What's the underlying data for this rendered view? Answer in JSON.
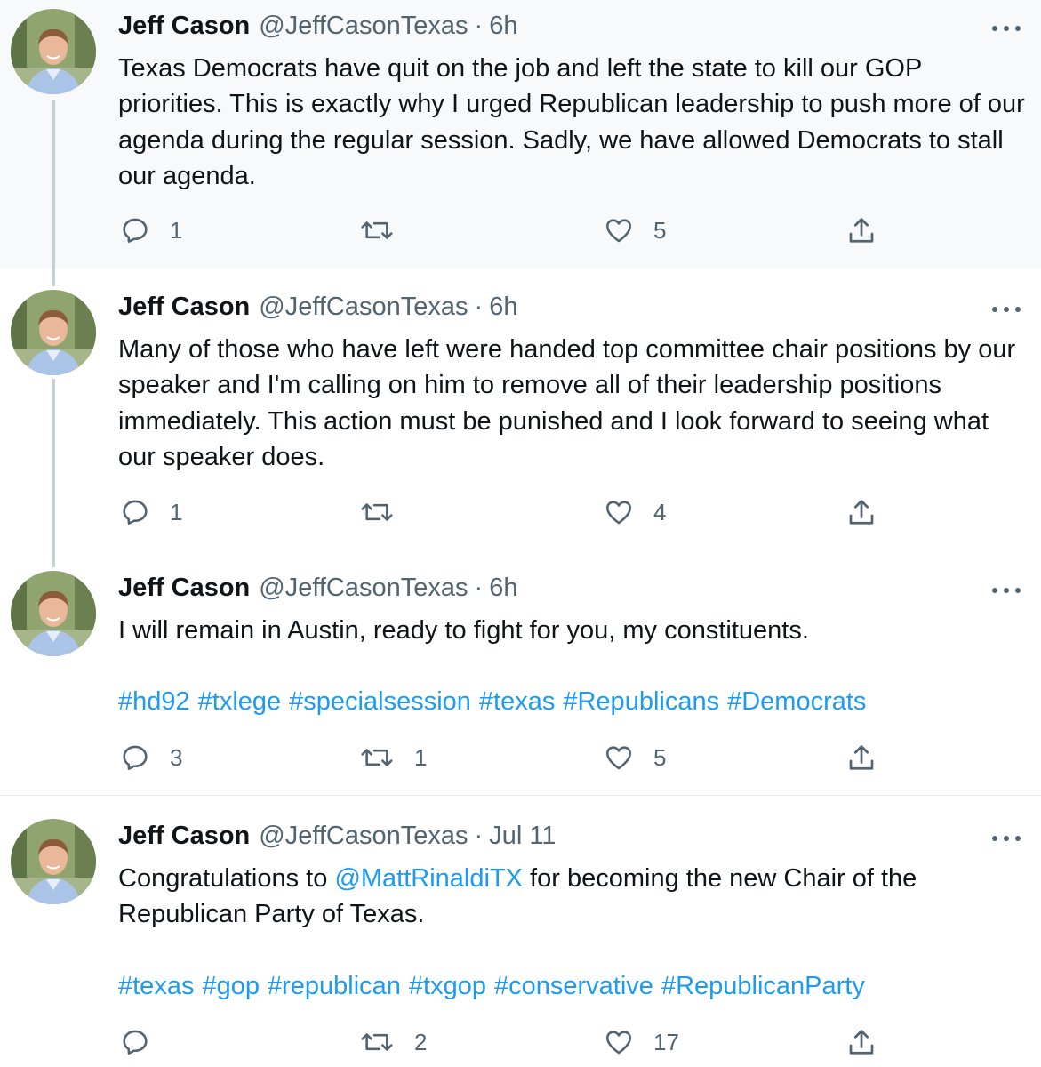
{
  "tweets": [
    {
      "name": "Jeff Cason",
      "handle": "@JeffCasonTexas",
      "separator": "·",
      "time": "6h",
      "text": "Texas Democrats have quit on the job and left the state to kill our GOP priorities. This is exactly why I urged Republican leadership to push more of our agenda during the regular session. Sadly, we have allowed Democrats to stall our agenda.",
      "replies": "1",
      "retweets": "",
      "likes": "5"
    },
    {
      "name": "Jeff Cason",
      "handle": "@JeffCasonTexas",
      "separator": "·",
      "time": "6h",
      "text": "Many of those who have left were handed top committee chair positions by our speaker and I'm calling on him to remove all of their leadership positions immediately. This action must be punished and I look forward to seeing what our speaker does.",
      "replies": "1",
      "retweets": "",
      "likes": "4"
    },
    {
      "name": "Jeff Cason",
      "handle": "@JeffCasonTexas",
      "separator": "·",
      "time": "6h",
      "text": "I will remain in Austin, ready to fight for you, my constituents.",
      "hashtags": [
        "#hd92",
        "#txlege",
        "#specialsession",
        "#texas",
        "#Republicans",
        "#Democrats"
      ],
      "replies": "3",
      "retweets": "1",
      "likes": "5"
    },
    {
      "name": "Jeff Cason",
      "handle": "@JeffCasonTexas",
      "separator": "·",
      "time": "Jul 11",
      "text_before": "Congratulations to ",
      "mention": "@MattRinaldiTX",
      "text_after": " for becoming the new Chair of the Republican Party of Texas.",
      "hashtags": [
        "#texas",
        "#gop",
        "#republican",
        "#txgop",
        "#conservative",
        "#RepublicanParty"
      ],
      "replies": "",
      "retweets": "2",
      "likes": "17"
    }
  ],
  "icons": {
    "reply": "reply-icon",
    "retweet": "retweet-icon",
    "like": "heart-icon",
    "share": "share-icon",
    "more": "more-icon",
    "avatar": "avatar"
  },
  "colors": {
    "link": "#1d9bf0",
    "secondary_text": "#536471",
    "highlight_background": "#f7f9fa",
    "thread_line": "#c4cfd6"
  }
}
